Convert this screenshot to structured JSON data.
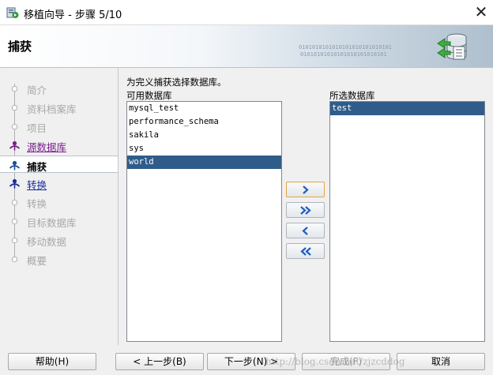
{
  "window": {
    "title": "移植向导 - 步骤 5/10",
    "close_glyph": "✕",
    "app_icon": "database-wizard-icon"
  },
  "header": {
    "title": "捕获",
    "binary_line1": "0101010101010101010101010101",
    "binary_line2": "01010101010101010101010101",
    "illustration_icon": "database-migrate-icon"
  },
  "steps": [
    {
      "label": "简介",
      "state": "disabled"
    },
    {
      "label": "资料档案库",
      "state": "disabled"
    },
    {
      "label": "项目",
      "state": "disabled"
    },
    {
      "label": "源数据库",
      "state": "visited"
    },
    {
      "label": "捕获",
      "state": "current"
    },
    {
      "label": "转换",
      "state": "link"
    },
    {
      "label": "转换",
      "state": "disabled"
    },
    {
      "label": "目标数据库",
      "state": "disabled"
    },
    {
      "label": "移动数据",
      "state": "disabled"
    },
    {
      "label": "概要",
      "state": "disabled"
    }
  ],
  "main": {
    "instruction": "为完义捕获选择数据库。",
    "available_label": "可用数据库",
    "selected_label": "所选数据库",
    "available": [
      {
        "name": "mysql_test",
        "selected": false
      },
      {
        "name": "performance_schema",
        "selected": false
      },
      {
        "name": "sakila",
        "selected": false
      },
      {
        "name": "sys",
        "selected": false
      },
      {
        "name": "world",
        "selected": true
      }
    ],
    "chosen": [
      {
        "name": "test",
        "selected": true
      }
    ]
  },
  "transfer_buttons": [
    {
      "name": "move-right-button",
      "icon": "chevron-right-icon"
    },
    {
      "name": "move-all-right-button",
      "icon": "double-chevron-right-icon"
    },
    {
      "name": "move-left-button",
      "icon": "chevron-left-icon"
    },
    {
      "name": "move-all-left-button",
      "icon": "double-chevron-left-icon"
    }
  ],
  "buttons": {
    "help": "帮助(H)",
    "back": "< 上一步(B)",
    "next": "下一步(N) >",
    "finish": "完成(F)",
    "cancel": "取消"
  },
  "watermark": "http://blog.csdn.net/zjzcddog",
  "colors": {
    "selection": "#2f5c8a",
    "link": "#1c2c9c",
    "visited": "#7a1e8e",
    "focus_border": "#e2a54a"
  }
}
